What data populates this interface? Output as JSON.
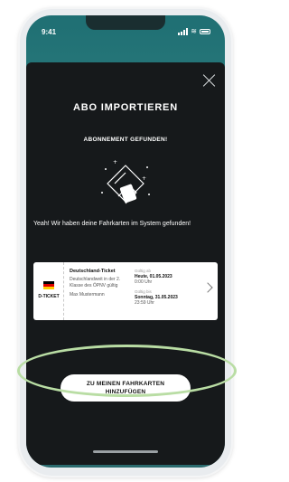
{
  "status_bar": {
    "time": "9:41"
  },
  "modal": {
    "title": "ABO IMPORTIEREN",
    "subtitle": "ABONNEMENT GEFUNDEN!",
    "message": "Yeah! Wir haben deine Fahrkarten im System gefunden!",
    "close_icon": "close-icon",
    "illustration_icon": "phone-with-ticket-icon"
  },
  "ticket": {
    "name": "Deutschland-Ticket",
    "badge_label": "D-TICKET",
    "description": "Deutschlandweit in der 2. Klasse des ÖPNV gültig",
    "holder": "Max Mustermann",
    "valid_from_label": "Gültig ab",
    "valid_from_date": "Heute, 01.05.2023",
    "valid_from_time": "0:00 Uhr",
    "valid_until_label": "Gültig bis",
    "valid_until_date": "Sonntag, 31.05.2023",
    "valid_until_time": "23:59 Uhr",
    "flag_colors": [
      "#000000",
      "#dd0000",
      "#ffce00"
    ]
  },
  "cta": {
    "line1": "ZU MEINEN FAHRKARTEN",
    "line2": "HINZUFÜGEN"
  },
  "colors": {
    "modal_bg": "#16191b",
    "highlight_ring": "#b9dda4",
    "app_background": "#2e7f80"
  }
}
